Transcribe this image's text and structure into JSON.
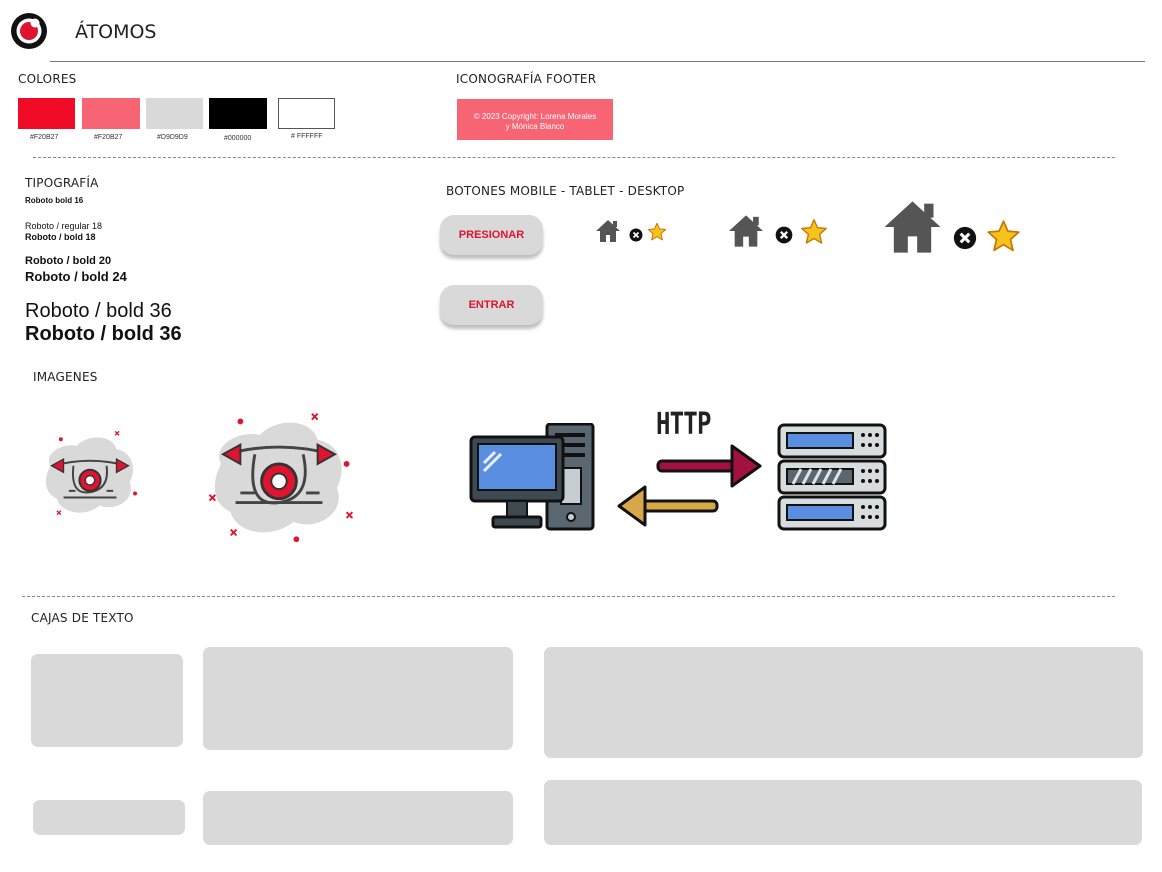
{
  "header": {
    "title": "ÁTOMOS"
  },
  "sections": {
    "colores": "COLORES",
    "iconografia_footer": "ICONOGRAFÍA FOOTER",
    "tipografia": "TIPOGRAFÍA",
    "botones": "BOTONES MOBILE - TABLET - DESKTOP",
    "imagenes": "IMAGENES",
    "cajas": "CAJAS DE TEXTO"
  },
  "colors": [
    {
      "hex": "#F20B27",
      "label": "#F20B27"
    },
    {
      "hex": "#F76574",
      "label": "#F20B27"
    },
    {
      "hex": "#D9D9D9",
      "label": "#D9D9D9"
    },
    {
      "hex": "#000000",
      "label": "#000000"
    },
    {
      "hex": "#FFFFFF",
      "label": "# FFFFFF"
    }
  ],
  "footer_sample": {
    "line1": "© 2023 Copyright: Lorena Morales",
    "line2": "y Mónica Blanco",
    "background": "#F76574"
  },
  "typography": [
    "Roboto bold  16",
    "Roboto / regular 18",
    "Roboto / bold 18",
    "Roboto / bold 20",
    "Roboto / bold 24",
    "Roboto / bold  36",
    "Roboto / bold  36"
  ],
  "buttons": {
    "primary": "PRESIONAR",
    "secondary": "ENTRAR"
  },
  "icons": [
    "home-icon",
    "close-circle-icon",
    "star-icon"
  ],
  "http_label": "HTTP"
}
